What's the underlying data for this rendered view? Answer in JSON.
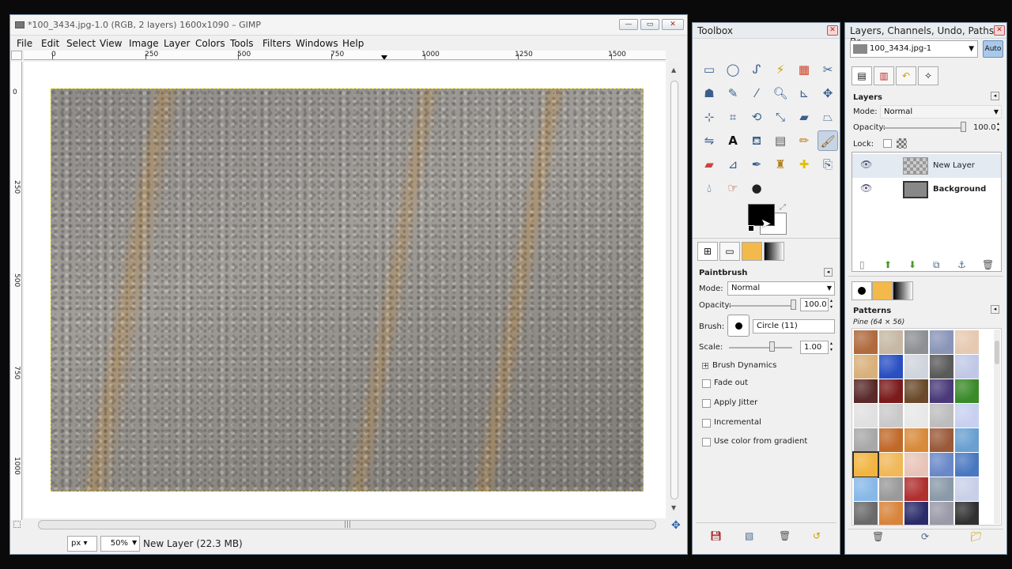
{
  "image_window": {
    "title": "*100_3434.jpg-1.0 (RGB, 2 layers) 1600x1090 – GIMP",
    "menu": [
      "File",
      "Edit",
      "Select",
      "View",
      "Image",
      "Layer",
      "Colors",
      "Tools",
      "Filters",
      "Windows",
      "Help"
    ],
    "ruler_h_labels": [
      "0",
      "250",
      "500",
      "750",
      "1000",
      "1250",
      "1500"
    ],
    "ruler_v_labels": [
      "0",
      "250",
      "500",
      "750",
      "1000"
    ],
    "status": {
      "unit": "px",
      "zoom": "50%",
      "message": "New Layer (22.3 MB)"
    }
  },
  "toolbox": {
    "title": "Toolbox",
    "tools": [
      "rect-select",
      "ellipse-select",
      "free-select",
      "fuzzy-select",
      "color-select",
      "scissors",
      "foreground-select",
      "paths",
      "color-picker",
      "zoom",
      "measure",
      "move",
      "align",
      "crop",
      "rotate",
      "scale",
      "shear",
      "perspective",
      "flip",
      "text",
      "bucket-fill",
      "blend",
      "pencil",
      "paintbrush",
      "eraser",
      "airbrush",
      "ink",
      "clone",
      "heal",
      "perspective-clone",
      "blur",
      "smudge",
      "dodge-burn"
    ],
    "selected_tool": "paintbrush",
    "fg_color": "#000000",
    "bg_color": "#ffffff"
  },
  "tool_options": {
    "title": "Paintbrush",
    "mode_label": "Mode:",
    "mode_value": "Normal",
    "opacity_label": "Opacity:",
    "opacity_value": "100.0",
    "brush_label": "Brush:",
    "brush_value": "Circle (11)",
    "scale_label": "Scale:",
    "scale_value": "1.00",
    "brush_dynamics": "Brush Dynamics",
    "checks": [
      "Fade out",
      "Apply Jitter",
      "Incremental",
      "Use color from gradient"
    ]
  },
  "layers_dock": {
    "title": "Layers, Channels, Undo, Paths - Br...",
    "image_select": "100_3434.jpg-1",
    "auto": "Auto",
    "section": "Layers",
    "mode_label": "Mode:",
    "mode_value": "Normal",
    "opacity_label": "Opacity:",
    "opacity_value": "100.0",
    "lock_label": "Lock:",
    "layers": [
      {
        "name": "New Layer",
        "bold": false
      },
      {
        "name": "Background",
        "bold": true
      }
    ]
  },
  "patterns": {
    "title": "Patterns",
    "selected": "Pine (64 × 56)",
    "swatches": [
      "#b06a3e",
      "#c5b8a4",
      "#8e9094",
      "#8a95b8",
      "#e6c9b0",
      "#d8b07a",
      "#2a4fc2",
      "#d0d4dc",
      "#5a5a5a",
      "#c0c8e6",
      "#5a2a2a",
      "#7a1a1a",
      "#6a4a2a",
      "#4a3a7a",
      "#3a8a2a",
      "#e0e0e0",
      "#c9c9c9",
      "#e8e8e8",
      "#bdbdbd",
      "#c8d0f0",
      "#a8a8a8",
      "#c06a2a",
      "#d88a3a",
      "#9a5a3a",
      "#6aa0d0",
      "#f2b440",
      "#f0b858",
      "#e8c4b8",
      "#6a88c8",
      "#4a78c0",
      "#88b8e8",
      "#9a9a9a",
      "#b03030",
      "#8a9aa8",
      "#c8d0e8",
      "#6a6a6a",
      "#d8843a",
      "#2a2a6a",
      "#9a9aa8",
      "#303030"
    ]
  }
}
